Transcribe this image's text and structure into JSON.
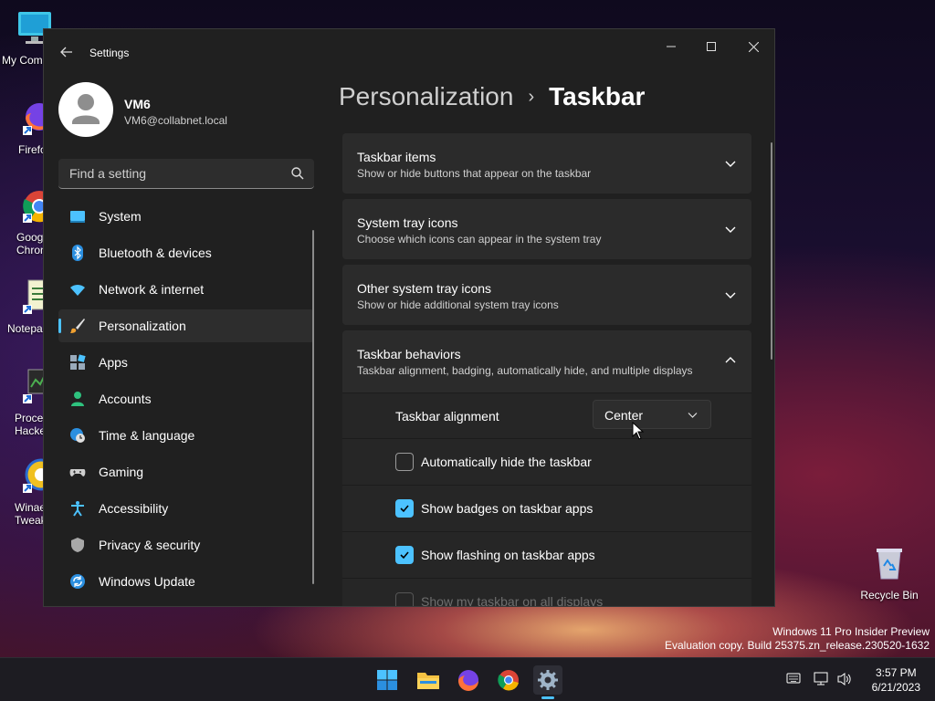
{
  "desktop": {
    "icons": [
      {
        "label": "My Com"
      },
      {
        "label": "Firefo"
      },
      {
        "label": "Goog Chron"
      },
      {
        "label": "Notepa"
      },
      {
        "label": "Proce Hacke"
      },
      {
        "label": "Winae Tweak"
      },
      {
        "label": "Recycle Bin"
      }
    ],
    "watermark": {
      "line1": "Windows 11 Pro Insider Preview",
      "line2": "Evaluation copy. Build 25375.zn_release.230520-1632"
    }
  },
  "window": {
    "title": "Settings",
    "back_icon": "arrow-left-icon",
    "profile": {
      "name": "VM6",
      "email": "VM6@collabnet.local"
    },
    "search": {
      "placeholder": "Find a setting"
    },
    "nav": [
      {
        "label": "System",
        "icon": "monitor-icon"
      },
      {
        "label": "Bluetooth & devices",
        "icon": "bluetooth-icon"
      },
      {
        "label": "Network & internet",
        "icon": "wifi-icon"
      },
      {
        "label": "Personalization",
        "icon": "brush-icon",
        "selected": true
      },
      {
        "label": "Apps",
        "icon": "apps-icon"
      },
      {
        "label": "Accounts",
        "icon": "person-icon"
      },
      {
        "label": "Time & language",
        "icon": "globe-clock-icon"
      },
      {
        "label": "Gaming",
        "icon": "gamepad-icon"
      },
      {
        "label": "Accessibility",
        "icon": "accessibility-icon"
      },
      {
        "label": "Privacy & security",
        "icon": "shield-icon"
      },
      {
        "label": "Windows Update",
        "icon": "update-icon"
      }
    ],
    "breadcrumb": {
      "parent": "Personalization",
      "separator": "›",
      "current": "Taskbar"
    },
    "sections": [
      {
        "title": "Taskbar items",
        "subtitle": "Show or hide buttons that appear on the taskbar",
        "expanded": false
      },
      {
        "title": "System tray icons",
        "subtitle": "Choose which icons can appear in the system tray",
        "expanded": false
      },
      {
        "title": "Other system tray icons",
        "subtitle": "Show or hide additional system tray icons",
        "expanded": false
      },
      {
        "title": "Taskbar behaviors",
        "subtitle": "Taskbar alignment, badging, automatically hide, and multiple displays",
        "expanded": true
      }
    ],
    "behaviors": {
      "alignment_label": "Taskbar alignment",
      "alignment_value": "Center",
      "options": [
        {
          "label": "Automatically hide the taskbar",
          "checked": false,
          "enabled": true
        },
        {
          "label": "Show badges on taskbar apps",
          "checked": true,
          "enabled": true
        },
        {
          "label": "Show flashing on taskbar apps",
          "checked": true,
          "enabled": true
        },
        {
          "label": "Show my taskbar on all displays",
          "checked": false,
          "enabled": false
        }
      ]
    }
  },
  "taskbar": {
    "apps": [
      {
        "name": "Start",
        "icon": "windows-logo-icon"
      },
      {
        "name": "File Explorer",
        "icon": "folder-icon"
      },
      {
        "name": "Firefox",
        "icon": "firefox-icon"
      },
      {
        "name": "Chrome",
        "icon": "chrome-icon"
      },
      {
        "name": "Settings",
        "icon": "gear-icon",
        "active": true
      }
    ],
    "clock": {
      "time": "3:57 PM",
      "date": "6/21/2023"
    }
  },
  "colors": {
    "accent": "#4cc2ff",
    "window_bg": "#202020",
    "card_bg": "#2b2b2b"
  }
}
